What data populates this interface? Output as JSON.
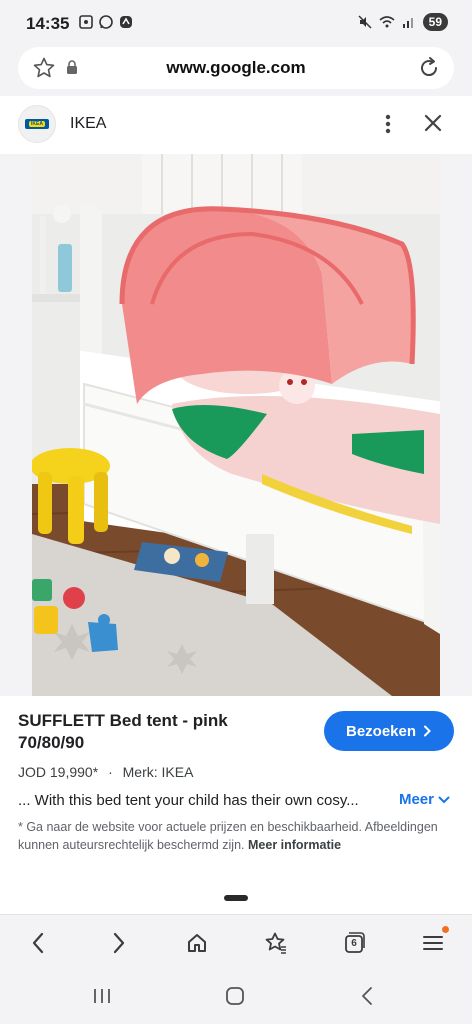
{
  "status_bar": {
    "time": "14:35",
    "battery": "59",
    "left_icons": [
      "screenshot-icon",
      "whatsapp-icon",
      "app-icon"
    ],
    "right_icons": [
      "mute-icon",
      "wifi-icon",
      "signal-icon"
    ]
  },
  "browser": {
    "url": "www.google.com"
  },
  "site": {
    "name": "IKEA",
    "logo_text": "IKEA"
  },
  "product": {
    "title": "SUFFLETT Bed tent - pink 70/80/90",
    "visit_label": "Bezoeken",
    "price": "JOD 19,990*",
    "separator": "·",
    "brand": "Merk: IKEA",
    "description": "... With this bed tent your child has their own cosy...",
    "more_label": "Meer",
    "disclaimer_text": "* Ga naar de website voor actuele prijzen en beschikbaarheid. Afbeeldingen kunnen auteursrechtelijk beschermd zijn.",
    "disclaimer_link": "Meer informatie"
  },
  "bottom_nav": {
    "tab_count": "6",
    "items": [
      "back-icon",
      "forward-icon",
      "home-icon",
      "bookmarks-icon",
      "tabs-icon",
      "menu-icon"
    ]
  },
  "colors": {
    "accent": "#1a73e8",
    "badge": "#f36f20",
    "background": "#f3f3f5"
  }
}
